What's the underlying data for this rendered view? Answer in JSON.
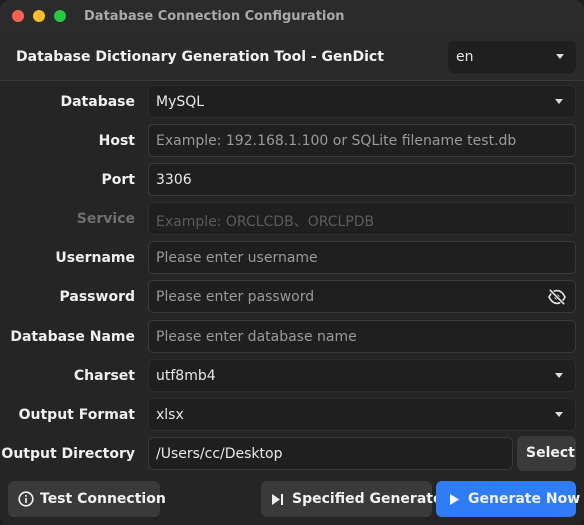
{
  "window": {
    "title": "Database Connection Configuration"
  },
  "header": {
    "app_title": "Database Dictionary Generation Tool - GenDict",
    "language": "en"
  },
  "form": {
    "database": {
      "label": "Database",
      "value": "MySQL"
    },
    "host": {
      "label": "Host",
      "placeholder": "Example: 192.168.1.100 or SQLite filename test.db"
    },
    "port": {
      "label": "Port",
      "value": "3306"
    },
    "service": {
      "label": "Service",
      "placeholder": "Example: ORCLCDB、ORCLPDB"
    },
    "username": {
      "label": "Username",
      "placeholder": "Please enter username"
    },
    "password": {
      "label": "Password",
      "placeholder": "Please enter password"
    },
    "database_name": {
      "label": "Database Name",
      "placeholder": "Please enter database name"
    },
    "charset": {
      "label": "Charset",
      "value": "utf8mb4"
    },
    "output_format": {
      "label": "Output Format",
      "value": "xlsx"
    },
    "output_directory": {
      "label": "Output Directory",
      "value": "/Users/cc/Desktop",
      "select_label": "Select"
    }
  },
  "footer": {
    "test_connection": "Test Connection",
    "specified_generate": "Specified Generate",
    "generate_now": "Generate Now"
  },
  "colors": {
    "accent": "#2f7cf6",
    "close": "#ff5f57",
    "minimize": "#febc2e",
    "zoom": "#28c840"
  },
  "icons": {
    "eye_off": "eye-off-icon",
    "info": "info-icon",
    "skip": "skip-icon",
    "play": "play-icon"
  }
}
